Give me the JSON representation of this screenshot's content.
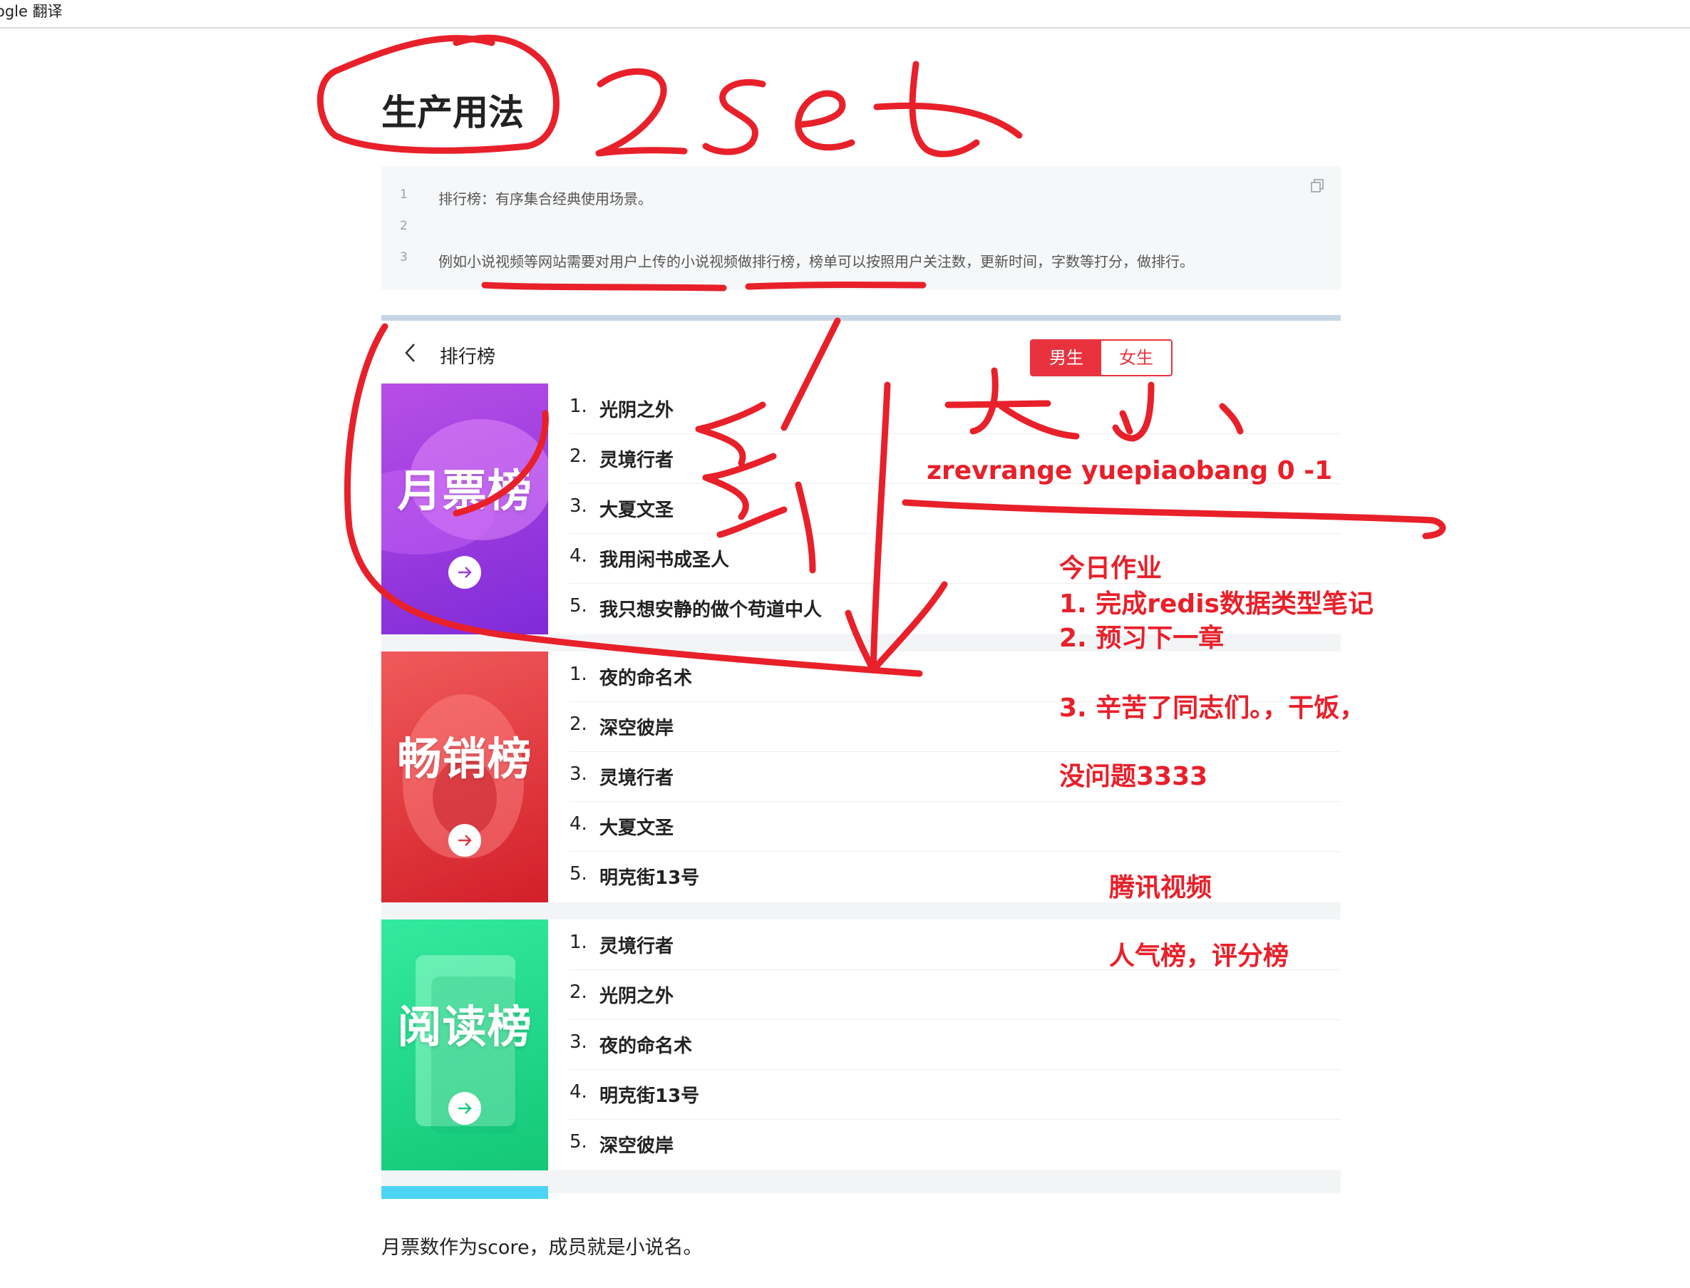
{
  "window": {
    "title": "ogle 翻译"
  },
  "heading": "生产用法",
  "code": {
    "lines": [
      {
        "num": "1",
        "text": "排行榜：有序集合经典使用场景。"
      },
      {
        "num": "2",
        "text": ""
      },
      {
        "num": "3",
        "text": "例如小说视频等网站需要对用户上传的小说视频做排行榜，榜单可以按照用户关注数，更新时间，字数等打分，做排行。"
      }
    ],
    "copy_icon": "copy-icon"
  },
  "ranking": {
    "title": "排行榜",
    "back_icon": "chevron-left-icon",
    "gender": {
      "male": "男生",
      "female": "女生"
    },
    "sections": [
      {
        "cover_title": "月票榜",
        "color": "#9b3be0",
        "items": [
          {
            "num": "1.",
            "name": "光阴之外"
          },
          {
            "num": "2.",
            "name": "灵境行者"
          },
          {
            "num": "3.",
            "name": "大夏文圣"
          },
          {
            "num": "4.",
            "name": "我用闲书成圣人"
          },
          {
            "num": "5.",
            "name": "我只想安静的做个苟道中人"
          }
        ]
      },
      {
        "cover_title": "畅销榜",
        "color": "#e5323b",
        "items": [
          {
            "num": "1.",
            "name": "夜的命名术"
          },
          {
            "num": "2.",
            "name": "深空彼岸"
          },
          {
            "num": "3.",
            "name": "灵境行者"
          },
          {
            "num": "4.",
            "name": "大夏文圣"
          },
          {
            "num": "5.",
            "name": "明克街13号"
          }
        ]
      },
      {
        "cover_title": "阅读榜",
        "color": "#1fd988",
        "items": [
          {
            "num": "1.",
            "name": "灵境行者"
          },
          {
            "num": "2.",
            "name": "光阴之外"
          },
          {
            "num": "3.",
            "name": "夜的命名术"
          },
          {
            "num": "4.",
            "name": "明克街13号"
          },
          {
            "num": "5.",
            "name": "深空彼岸"
          }
        ]
      }
    ]
  },
  "footer": "月票数作为score，成员就是小说名。",
  "annotations": {
    "handwritten_title": "zset",
    "handwritten_size": "大 小",
    "command": "zrevrange  yuepiaobang 0 -1",
    "homework_title": "今日作业",
    "homework_1": "1. 完成redis数据类型笔记",
    "homework_2": "2. 预习下一章",
    "homework_3": "3. 辛苦了同志们。，干饭，",
    "homework_4": "没问题3333",
    "tencent": "腾讯视频",
    "popular": "人气榜，评分榜",
    "ink_color": "#e8202a"
  }
}
